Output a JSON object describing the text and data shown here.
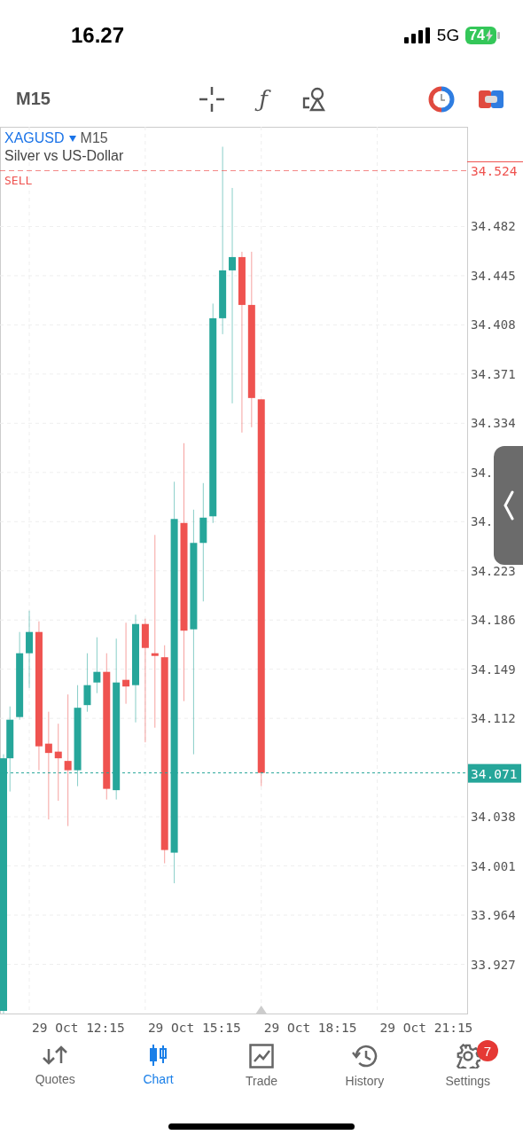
{
  "status_bar": {
    "time": "16.27",
    "network": "5G",
    "battery": "74"
  },
  "toolbar": {
    "timeframe": "M15",
    "indicator_glyph": "ƒ"
  },
  "chart": {
    "symbol": "XAGUSD",
    "timeframe": "M15",
    "description": "Silver vs US-Dollar",
    "price_axis": [
      "34.482",
      "34.445",
      "34.408",
      "34.371",
      "34.334",
      "34.",
      "34.",
      "34.223",
      "34.186",
      "34.149",
      "34.112",
      "34.038",
      "34.001",
      "33.964",
      "33.927"
    ],
    "time_axis": [
      "29 Oct 12:15",
      "29 Oct 15:15",
      "29 Oct 18:15",
      "29 Oct 21:15"
    ],
    "sell_line": {
      "label": "SELL",
      "price": "34.524"
    },
    "current_price": "34.071"
  },
  "nav": [
    {
      "kind": "quotes",
      "label": "Quotes",
      "selected": false
    },
    {
      "kind": "chart",
      "label": "Chart",
      "selected": true
    },
    {
      "kind": "trade",
      "label": "Trade",
      "selected": false
    },
    {
      "kind": "history",
      "label": "History",
      "selected": false
    },
    {
      "kind": "settings",
      "label": "Settings",
      "selected": false,
      "badge": "7"
    }
  ]
}
